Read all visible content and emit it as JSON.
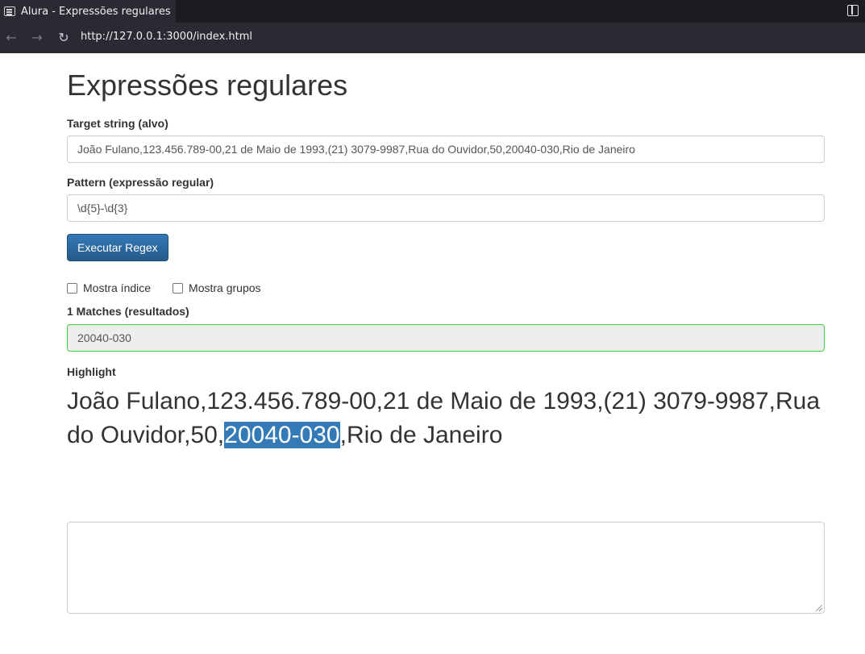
{
  "browser": {
    "tab_title": "Alura - Expressões regulares",
    "url": "http://127.0.0.1:3000/index.html"
  },
  "page": {
    "title": "Expressões regulares",
    "target_label": "Target string (alvo)",
    "target_value": "João Fulano,123.456.789-00,21 de Maio de 1993,(21) 3079-9987,Rua do Ouvidor,50,20040-030,Rio de Janeiro",
    "pattern_label": "Pattern (expressão regular)",
    "pattern_value": "\\d{5}-\\d{3}",
    "execute_button": "Executar Regex",
    "show_index_label": "Mostra índice",
    "show_groups_label": "Mostra grupos",
    "matches_label": "1 Matches (resultados)",
    "matches_value": "20040-030",
    "highlight_label": "Highlight",
    "highlight_before": "João Fulano,123.456.789-00,21 de Maio de 1993,(21) 3079-9987,Rua do Ouvidor,50,",
    "highlight_match": "20040-030",
    "highlight_after": ",Rio de Janeiro",
    "textarea_value": ""
  },
  "colors": {
    "accent": "#337ab7",
    "match_border": "#3ecf3e"
  }
}
